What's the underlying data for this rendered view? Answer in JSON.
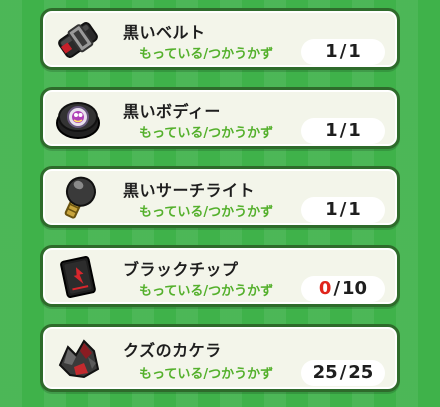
{
  "items": [
    {
      "name": "黒いベルト",
      "owned_label": "もっている",
      "needed_label": "つかうかず",
      "owned": "1",
      "needed": "1",
      "icon": "black-belt-icon"
    },
    {
      "name": "黒いボディー",
      "owned_label": "もっている",
      "needed_label": "つかうかず",
      "owned": "1",
      "needed": "1",
      "icon": "black-body-icon"
    },
    {
      "name": "黒いサーチライト",
      "owned_label": "もっている",
      "needed_label": "つかうかず",
      "owned": "1",
      "needed": "1",
      "icon": "black-searchlight-icon"
    },
    {
      "name": "ブラックチップ",
      "owned_label": "もっている",
      "needed_label": "つかうかず",
      "owned": "0",
      "needed": "10",
      "icon": "black-chip-icon"
    },
    {
      "name": "クズのカケラ",
      "owned_label": "もっている",
      "needed_label": "つかうかず",
      "owned": "25",
      "needed": "25",
      "icon": "scrap-fragment-icon"
    }
  ],
  "caption_separator": "/",
  "counter_separator": "/",
  "colors": {
    "background": "#3fb24a",
    "card": "#f3f5ea",
    "card_border": "#2e6b2b",
    "caption": "#54b02c",
    "insufficient": "#e0241b"
  }
}
